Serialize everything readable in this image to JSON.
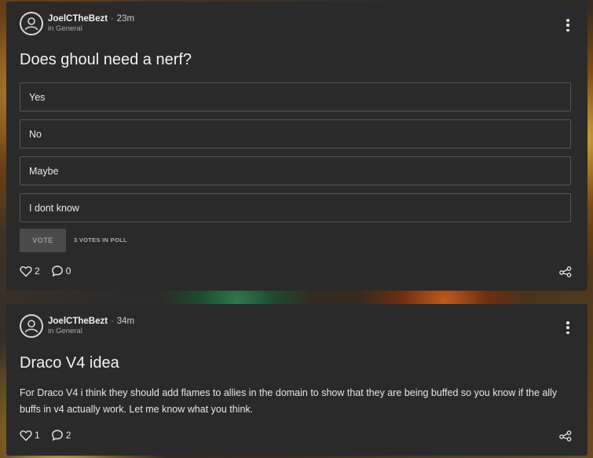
{
  "posts": [
    {
      "author": "JoelCTheBezt",
      "time": "23m",
      "category": "in General",
      "title": "Does ghoul need a nerf?",
      "poll": {
        "options": [
          "Yes",
          "No",
          "Maybe",
          "I dont know"
        ],
        "vote_label": "VOTE",
        "votes_text": "3 VOTES IN POLL"
      },
      "likes": "2",
      "comments": "0"
    },
    {
      "author": "JoelCTheBezt",
      "time": "34m",
      "category": "in General",
      "title": "Draco V4 idea",
      "body": "For Draco V4 i think they should add flames to allies in the domain to show that they are being buffed so you know if the ally buffs in v4 actually work. Let me know what you think.",
      "likes": "1",
      "comments": "2"
    }
  ],
  "icons": [
    "avatar-icon",
    "more-options-icon",
    "heart-icon",
    "comment-icon",
    "share-icon"
  ]
}
